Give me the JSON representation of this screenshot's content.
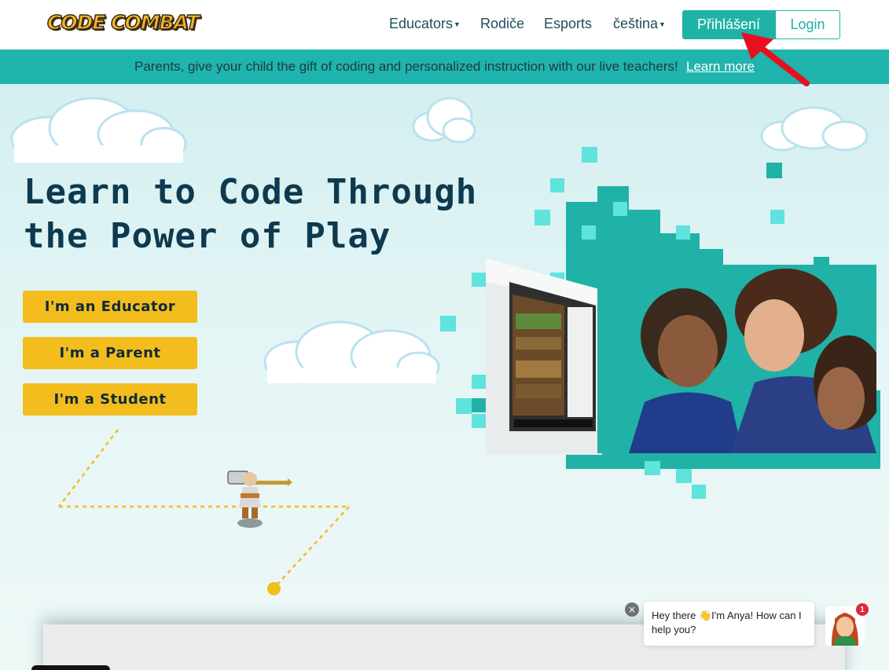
{
  "header": {
    "logo_text": "CODE COMBAT",
    "nav": [
      {
        "label": "Educators",
        "has_caret": true
      },
      {
        "label": "Rodiče",
        "has_caret": false
      },
      {
        "label": "Esports",
        "has_caret": false
      },
      {
        "label": "čeština",
        "has_caret": true
      }
    ],
    "signup_label": "Přihlášení",
    "login_label": "Login"
  },
  "banner": {
    "text": "Parents, give your child the gift of coding and personalized instruction with our live teachers!",
    "link": "Learn more"
  },
  "hero": {
    "headline_line1": "Learn to Code Through",
    "headline_line2": "the Power of Play",
    "buttons": [
      {
        "label": "I'm an Educator"
      },
      {
        "label": "I'm a Parent"
      },
      {
        "label": "I'm a Student"
      }
    ]
  },
  "chat": {
    "message_part1": "Hey there ",
    "message_emoji": "👋",
    "message_part2": "I'm Anya! How can I help you?",
    "badge_count": "1",
    "close_symbol": "×"
  },
  "colors": {
    "teal": "#20b2a6",
    "banner": "#1fb4ad",
    "cta_yellow": "#f2bd1d",
    "headline": "#0e3a4f",
    "annotation_arrow": "#e8101f"
  },
  "icons": [
    "caret-down-icon",
    "close-icon",
    "annotation-arrow-icon"
  ]
}
